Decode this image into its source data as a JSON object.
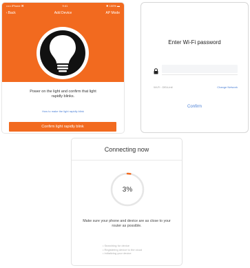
{
  "colors": {
    "brand_orange": "#f26a1f",
    "link_blue": "#4a7fd6",
    "progress_orange": "#f26a1f"
  },
  "add_device": {
    "status_left": "••••• iPhone ⌘",
    "status_center": "9:41",
    "status_right": "✱ 100% ▬",
    "back_label": "Back",
    "title": "Add Device",
    "right_action": "AP Mode",
    "illustration_icon": "light-bulb-icon",
    "instruction": "Power on the light and confirm that light rapidly blinks.",
    "help_link": "How to make the light rapidly blink",
    "confirm_button": "Confirm light rapidly blink"
  },
  "wifi": {
    "title": "Enter Wi-Fi password",
    "lock_icon": "lock-icon",
    "password_value": "",
    "ssid_label": "Wi-Fi : DEA-Intl",
    "change_network": "Change Network",
    "confirm": "Confirm"
  },
  "connecting": {
    "title": "Connecting now",
    "progress_percent": 3,
    "progress_label": "3%",
    "description": "Make sure your phone and device are as close to your router as possible.",
    "steps": [
      "• Searching for device",
      "• Registering device to the cloud",
      "• Initializing your device"
    ]
  }
}
